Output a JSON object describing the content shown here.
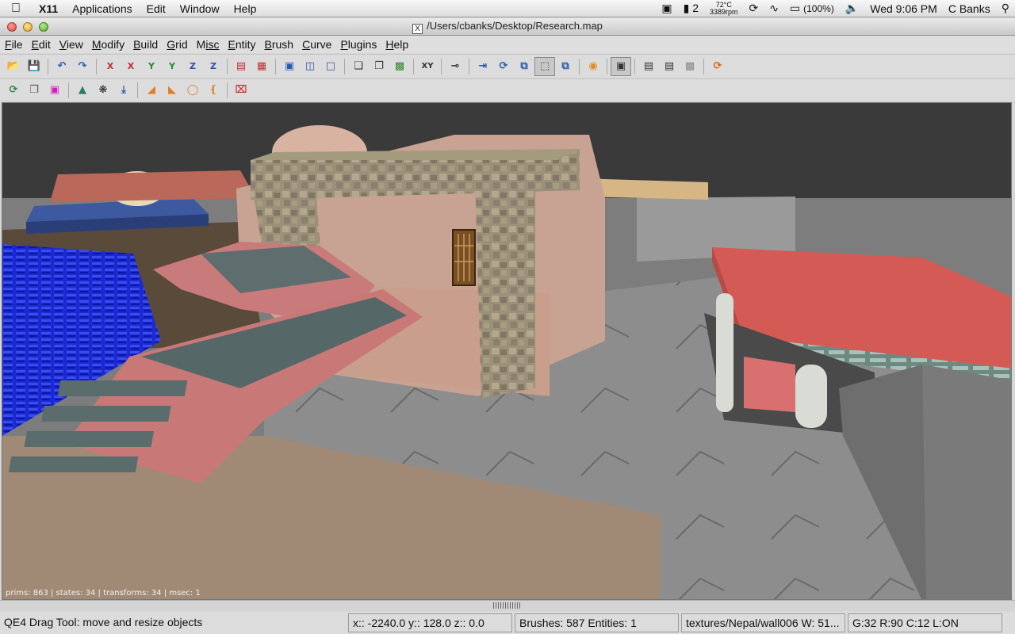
{
  "menubar": {
    "app": "X11",
    "items": [
      "Applications",
      "Edit",
      "Window",
      "Help"
    ],
    "spaces": "2",
    "temp": "72°C",
    "fan": "3389rpm",
    "battery": "(100%)",
    "clock": "Wed 9:06 PM",
    "user": "C Banks"
  },
  "window": {
    "title": "/Users/cbanks/Desktop/Research.map",
    "title_icon": "X"
  },
  "app_menu": [
    {
      "u": "F",
      "rest": "ile"
    },
    {
      "u": "E",
      "rest": "dit"
    },
    {
      "u": "V",
      "rest": "iew"
    },
    {
      "u": "M",
      "rest": "odify"
    },
    {
      "u": "B",
      "rest": "uild"
    },
    {
      "u": "G",
      "rest": "rid"
    },
    {
      "u": "M",
      "rest": "isc"
    },
    {
      "u": "E",
      "rest": "ntity"
    },
    {
      "u": "B",
      "rest": "rush"
    },
    {
      "u": "C",
      "rest": "urve"
    },
    {
      "u": "P",
      "rest": "lugins"
    },
    {
      "u": "H",
      "rest": "elp"
    }
  ],
  "toolbar1": {
    "flip_x": "X",
    "rotate_x": "X",
    "flip_y": "Y",
    "rotate_y": "Y",
    "flip_z": "Z",
    "rotate_z": "Z",
    "xy_label": "XY"
  },
  "viewport": {
    "stats": "prims: 863 | states: 34 | transforms: 34 | msec: 1"
  },
  "status": {
    "tool": "QE4 Drag Tool: move and resize objects",
    "coords": "x:: -2240.0  y:: 128.0  z::    0.0",
    "counts": "Brushes: 587 Entities: 1",
    "texture": "textures/Nepal/wall006 W: 51...",
    "grid": "G:32  R:90  C:12  L:ON"
  },
  "colors": {
    "viewport_sky": "#3a3a3a",
    "ground": "#a08a76",
    "stone_floor": "#8a8a8a",
    "red_roof": "#d45a55",
    "blue_wall": "#1a2ad0"
  }
}
